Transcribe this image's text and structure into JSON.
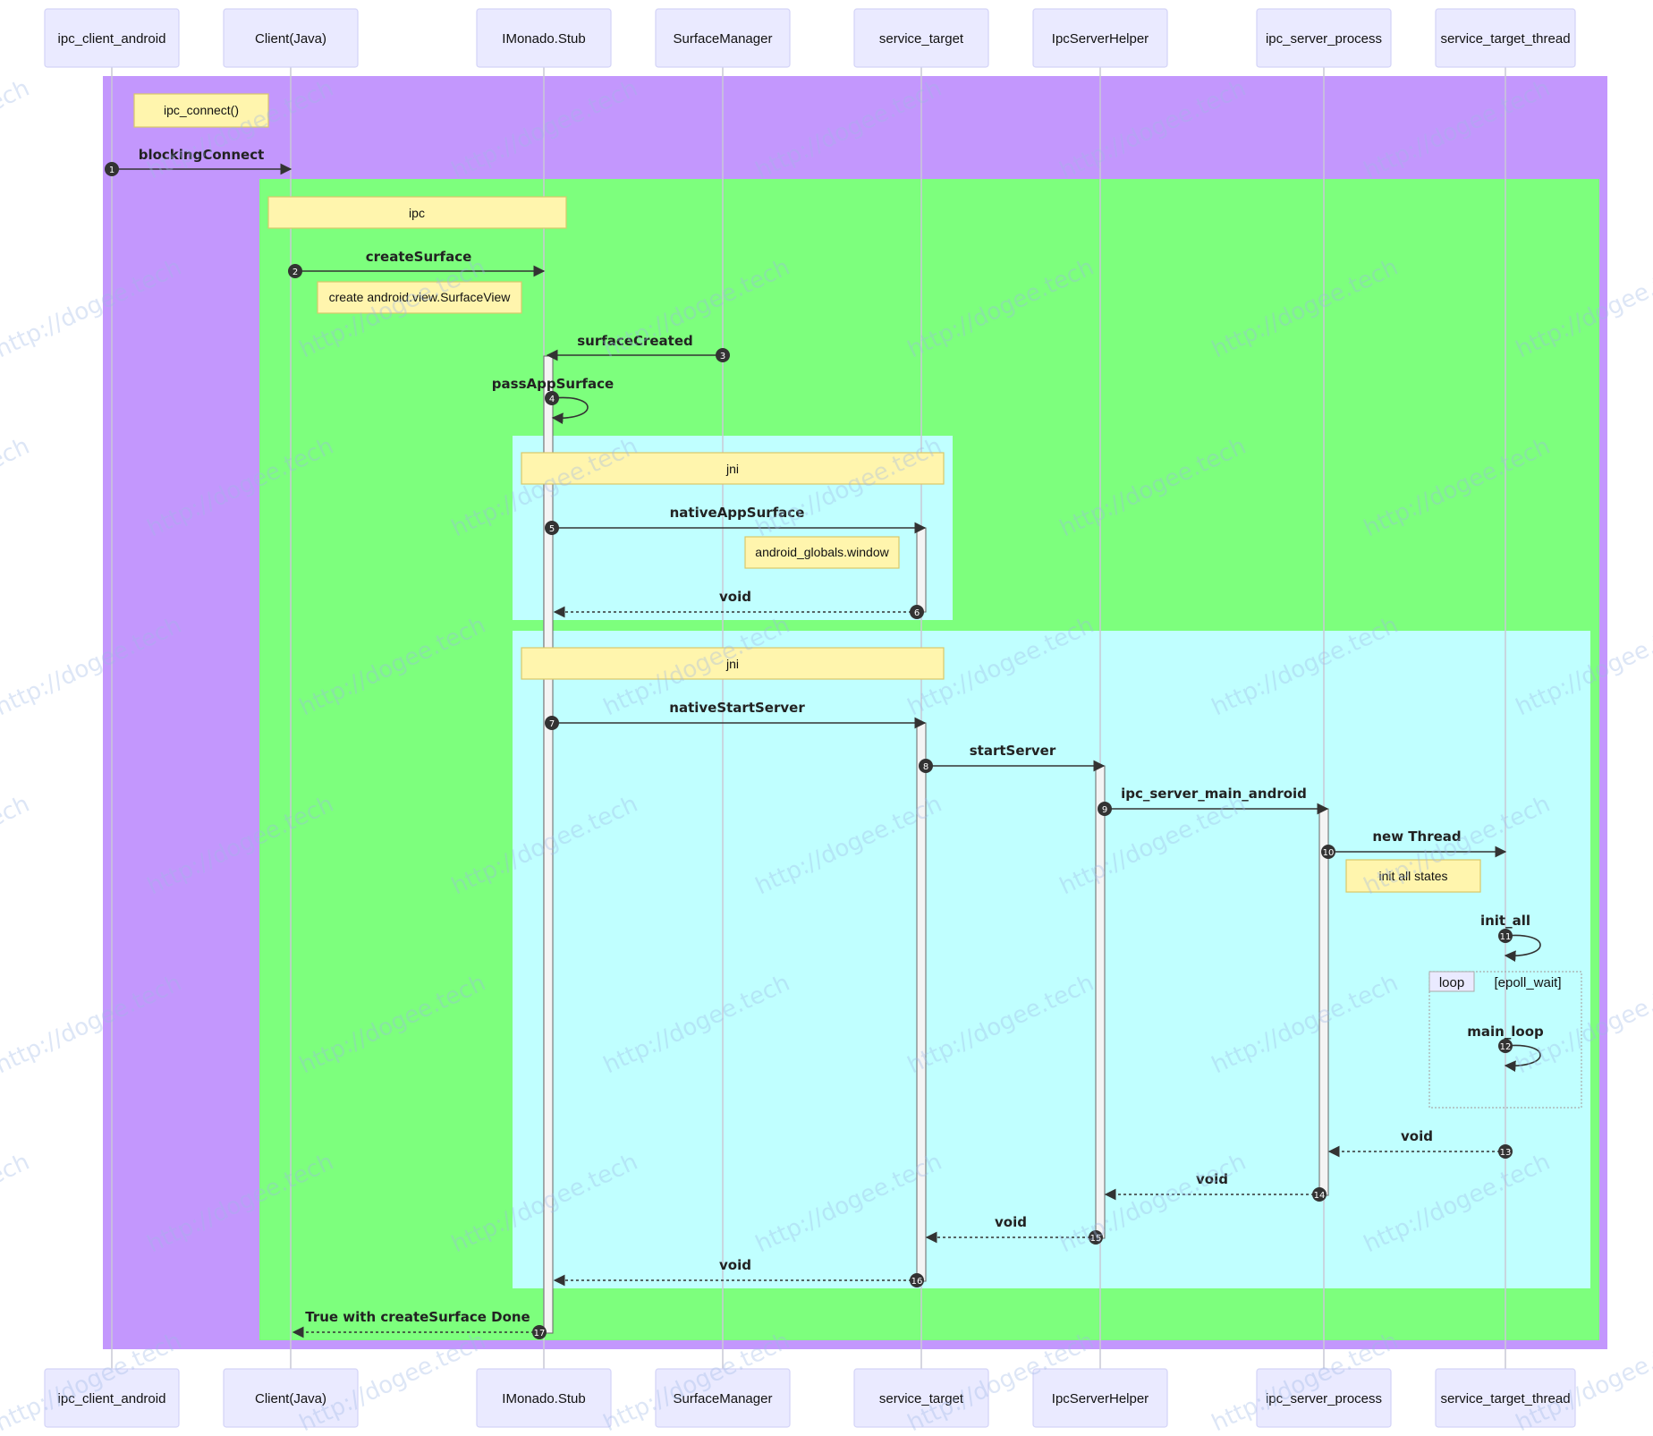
{
  "colors": {
    "outer_rect": "#c397fd",
    "ipc_rect": "#7dff7d",
    "jni_rect": "#c0ffff",
    "actor_fill": "#eaeaff",
    "note_fill": "#fff5ad"
  },
  "watermark_text": "http://dogee.tech",
  "actors": [
    {
      "id": "ipc_client_android",
      "label": "ipc_client_android"
    },
    {
      "id": "client_java",
      "label": "Client(Java)"
    },
    {
      "id": "imonado_stub",
      "label": "IMonado.Stub"
    },
    {
      "id": "surface_manager",
      "label": "SurfaceManager"
    },
    {
      "id": "service_target",
      "label": "service_target"
    },
    {
      "id": "ipc_server_helper",
      "label": "IpcServerHelper"
    },
    {
      "id": "ipc_server_process",
      "label": "ipc_server_process"
    },
    {
      "id": "service_target_thread",
      "label": "service_target_thread"
    }
  ],
  "notes": [
    {
      "id": "ipc_connect",
      "text": "ipc_connect()"
    },
    {
      "id": "ipc",
      "text": "ipc"
    },
    {
      "id": "create_surfaceview",
      "text": "create android.view.SurfaceView"
    },
    {
      "id": "jni_1",
      "text": "jni"
    },
    {
      "id": "android_globals",
      "text": "android_globals.window"
    },
    {
      "id": "jni_2",
      "text": "jni"
    },
    {
      "id": "init_all_states",
      "text": "init all states"
    }
  ],
  "messages": [
    {
      "seq": "1",
      "label": "blockingConnect",
      "from": "ipc_client_android",
      "to": "client_java",
      "style": "solid"
    },
    {
      "seq": "2",
      "label": "createSurface",
      "from": "client_java",
      "to": "imonado_stub",
      "style": "solid"
    },
    {
      "seq": "3",
      "label": "surfaceCreated",
      "from": "surface_manager",
      "to": "imonado_stub",
      "style": "solid"
    },
    {
      "seq": "4",
      "label": "passAppSurface",
      "from": "imonado_stub",
      "to": "imonado_stub",
      "style": "self"
    },
    {
      "seq": "5",
      "label": "nativeAppSurface",
      "from": "imonado_stub",
      "to": "service_target",
      "style": "solid"
    },
    {
      "seq": "6",
      "label": "void",
      "from": "service_target",
      "to": "imonado_stub",
      "style": "dotted"
    },
    {
      "seq": "7",
      "label": "nativeStartServer",
      "from": "imonado_stub",
      "to": "service_target",
      "style": "solid"
    },
    {
      "seq": "8",
      "label": "startServer",
      "from": "service_target",
      "to": "ipc_server_helper",
      "style": "solid"
    },
    {
      "seq": "9",
      "label": "ipc_server_main_android",
      "from": "ipc_server_helper",
      "to": "ipc_server_process",
      "style": "solid"
    },
    {
      "seq": "10",
      "label": "new Thread",
      "from": "ipc_server_process",
      "to": "service_target_thread",
      "style": "solid"
    },
    {
      "seq": "11",
      "label": "init_all",
      "from": "service_target_thread",
      "to": "service_target_thread",
      "style": "self"
    },
    {
      "seq": "12",
      "label": "main_loop",
      "from": "service_target_thread",
      "to": "service_target_thread",
      "style": "self"
    },
    {
      "seq": "13",
      "label": "void",
      "from": "service_target_thread",
      "to": "ipc_server_process",
      "style": "dotted"
    },
    {
      "seq": "14",
      "label": "void",
      "from": "ipc_server_process",
      "to": "ipc_server_helper",
      "style": "dotted"
    },
    {
      "seq": "15",
      "label": "void",
      "from": "ipc_server_helper",
      "to": "service_target",
      "style": "dotted"
    },
    {
      "seq": "16",
      "label": "void",
      "from": "service_target",
      "to": "imonado_stub",
      "style": "dotted"
    },
    {
      "seq": "17",
      "label": "True with createSurface Done",
      "from": "imonado_stub",
      "to": "client_java",
      "style": "dotted"
    }
  ],
  "loop": {
    "keyword": "loop",
    "condition": "[epoll_wait]"
  }
}
